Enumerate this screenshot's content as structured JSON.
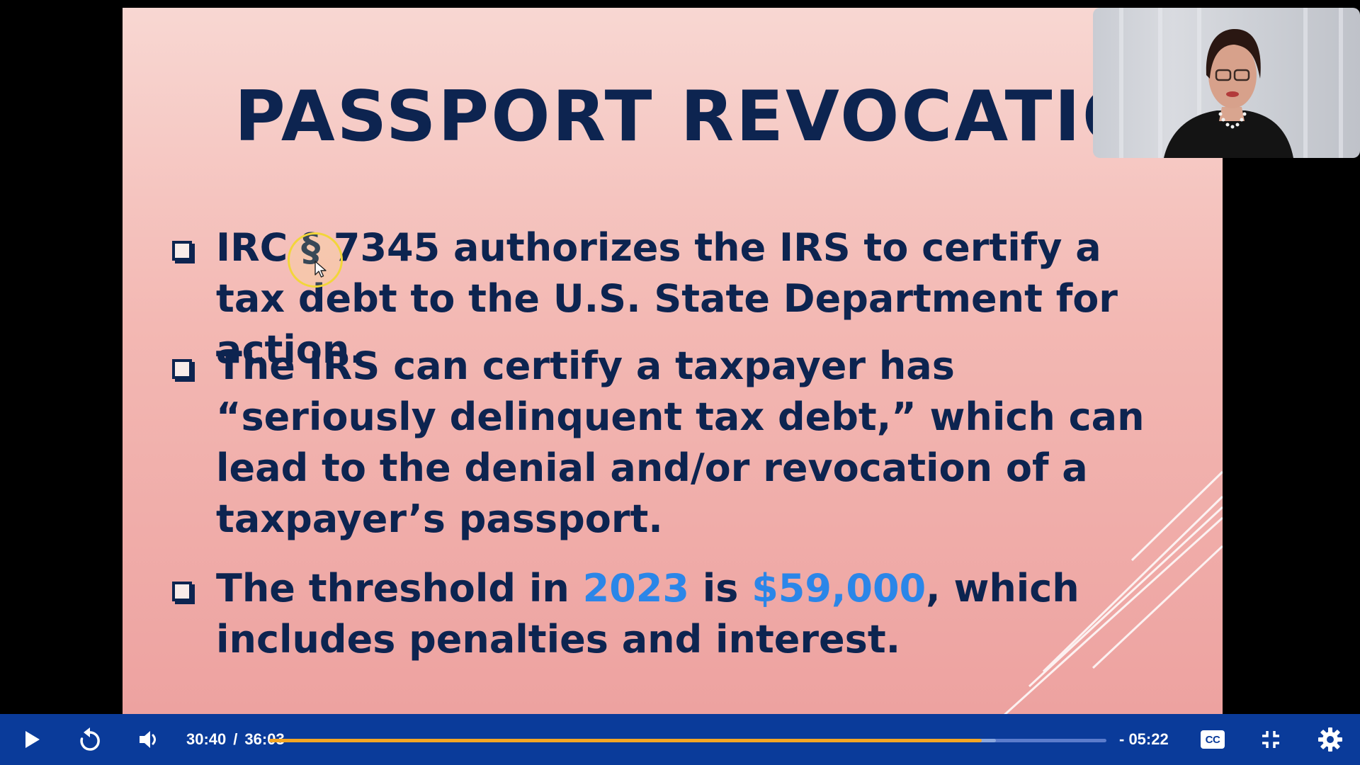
{
  "slide": {
    "title": "PASSPORT REVOCATIONS",
    "bullets": [
      {
        "text": "IRC § 7345 authorizes the IRS to certify a tax debt to the U.S. State Department for action."
      },
      {
        "text": "The IRS can certify a taxpayer has “seriously delinquent tax debt,” which can lead to the denial and/or revocation of a taxpayer’s passport."
      },
      {
        "before": "The threshold in ",
        "year": "2023",
        "middle": " is ",
        "amount": "$59,000",
        "after": ", which includes penalties and interest."
      }
    ],
    "highlight_color": "#2b86e8",
    "text_color": "#0d2450"
  },
  "player": {
    "current_time": "30:40",
    "separator": "/",
    "duration": "36:03",
    "remaining": "- 05:22",
    "progress_fraction": 0.851,
    "buffered_fraction": 0.868,
    "cc_label": "CC",
    "bar_color": "#0a3b9a",
    "progress_color": "#f5a623",
    "icons": [
      "play-icon",
      "replay-icon",
      "volume-icon",
      "cc-icon",
      "exit-fullscreen-icon",
      "gear-icon"
    ]
  }
}
